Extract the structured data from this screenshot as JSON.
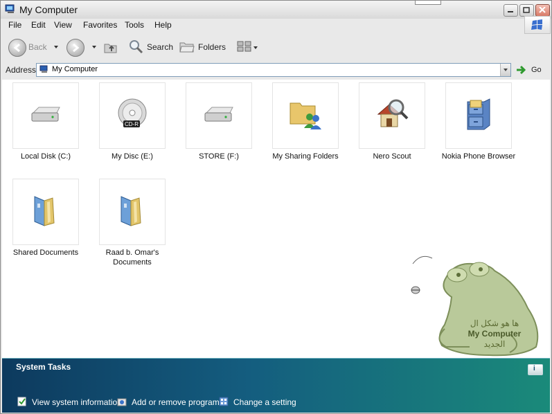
{
  "window": {
    "title": "My Computer"
  },
  "menu": {
    "items": [
      "File",
      "Edit",
      "View",
      "Favorites",
      "Tools",
      "Help"
    ]
  },
  "toolbar": {
    "back_label": "Back",
    "search_label": "Search",
    "folders_label": "Folders"
  },
  "address": {
    "label": "Address",
    "value": "My Computer",
    "go_label": "Go"
  },
  "items": [
    {
      "label": "Local Disk (C:)",
      "icon": "hard-disk-icon"
    },
    {
      "label": "My Disc (E:)",
      "icon": "cd-drive-icon",
      "badge": "CD-R"
    },
    {
      "label": "STORE (F:)",
      "icon": "hard-disk-icon"
    },
    {
      "label": "My Sharing Folders",
      "icon": "shared-folder-icon"
    },
    {
      "label": "Nero Scout",
      "icon": "house-magnifier-icon"
    },
    {
      "label": "Nokia Phone Browser",
      "icon": "file-cabinet-icon"
    },
    {
      "label": "Shared Documents",
      "icon": "documents-folder-icon"
    },
    {
      "label": "Raad b. Omar's Documents",
      "icon": "documents-folder-icon"
    }
  ],
  "watermark": {
    "line1": "ها هو شكل ال",
    "line2": "My Computer",
    "line3": "الجديد"
  },
  "tasks": {
    "title": "System Tasks",
    "links": [
      "View system information",
      "Add or remove programs",
      "Change a setting"
    ]
  },
  "colors": {
    "tasks_gradient_start": "#0d3a5e",
    "tasks_gradient_end": "#1a8a7a",
    "address_border": "#7f9db9"
  }
}
